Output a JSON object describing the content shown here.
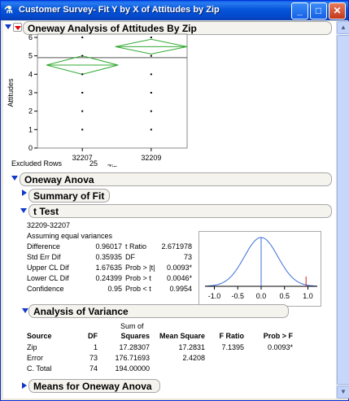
{
  "window": {
    "title": "Customer Survey- Fit Y by X of Attitudes by Zip",
    "app_icon": "jmp-icon",
    "buttons": [
      "minimize",
      "maximize",
      "close"
    ]
  },
  "oneway_plot": {
    "header": "Oneway Analysis of Attitudes By Zip",
    "chart_data": {
      "type": "scatter",
      "xlabel": "Zip",
      "ylabel": "Attitudes",
      "categories": [
        "32207",
        "32209"
      ],
      "ylim": [
        0,
        6
      ],
      "yticks": [
        "0",
        "1",
        "2",
        "3",
        "4",
        "5",
        "6"
      ],
      "grand_mean": 4.9,
      "points": {
        "32207": [
          6,
          5,
          4,
          3,
          2,
          1
        ],
        "32209": [
          6,
          5,
          4,
          3,
          2,
          1
        ]
      },
      "means_diamonds": [
        {
          "category": "32207",
          "mean": 4.5,
          "lower": 4.0,
          "upper": 5.0
        },
        {
          "category": "32209",
          "mean": 5.5,
          "lower": 5.1,
          "upper": 5.9
        }
      ]
    }
  },
  "excluded_rows": {
    "label": "Excluded Rows",
    "value": "25"
  },
  "oneway_anova": {
    "header": "Oneway Anova"
  },
  "summary_of_fit": {
    "header": "Summary of Fit"
  },
  "t_test": {
    "header": "t Test",
    "comparison": "32209-32207",
    "assumption": "Assuming equal variances",
    "rows": [
      {
        "label": "Difference",
        "value": "0.96017",
        "label2": "t Ratio",
        "value2": "2.671978"
      },
      {
        "label": "Std Err Dif",
        "value": "0.35935",
        "label2": "DF",
        "value2": "73"
      },
      {
        "label": "Upper CL Dif",
        "value": "1.67635",
        "label2": "Prob > |t|",
        "value2": "0.0093*"
      },
      {
        "label": "Lower CL Dif",
        "value": "0.24399",
        "label2": "Prob > t",
        "value2": "0.0046*"
      },
      {
        "label": "Confidence",
        "value": "0.95",
        "label2": "Prob < t",
        "value2": "0.9954"
      }
    ],
    "dist_chart": {
      "type": "line",
      "xticks": [
        "-1.0",
        "-0.5",
        "0.0",
        "0.5",
        "1.0"
      ],
      "xlim": [
        -1.2,
        1.2
      ],
      "observed_difference": 0.96017
    }
  },
  "analysis_of_variance": {
    "header": "Analysis of Variance",
    "col_group": "Sum of",
    "columns": [
      "Source",
      "DF",
      "Squares",
      "Mean Square",
      "F Ratio",
      "Prob > F"
    ],
    "rows": [
      {
        "source": "Zip",
        "df": "1",
        "ss": "17.28307",
        "ms": "17.2831",
        "f": "7.1395",
        "p": "0.0093*"
      },
      {
        "source": "Error",
        "df": "73",
        "ss": "176.71693",
        "ms": "2.4208",
        "f": "",
        "p": ""
      },
      {
        "source": "C. Total",
        "df": "74",
        "ss": "194.00000",
        "ms": "",
        "f": "",
        "p": ""
      }
    ]
  },
  "means_oneway": {
    "header": "Means for Oneway Anova"
  },
  "colors": {
    "diamond": "#33aa33",
    "curve": "#3a6fd8",
    "observed": "#d02020",
    "titlebar": "#0554d9"
  }
}
